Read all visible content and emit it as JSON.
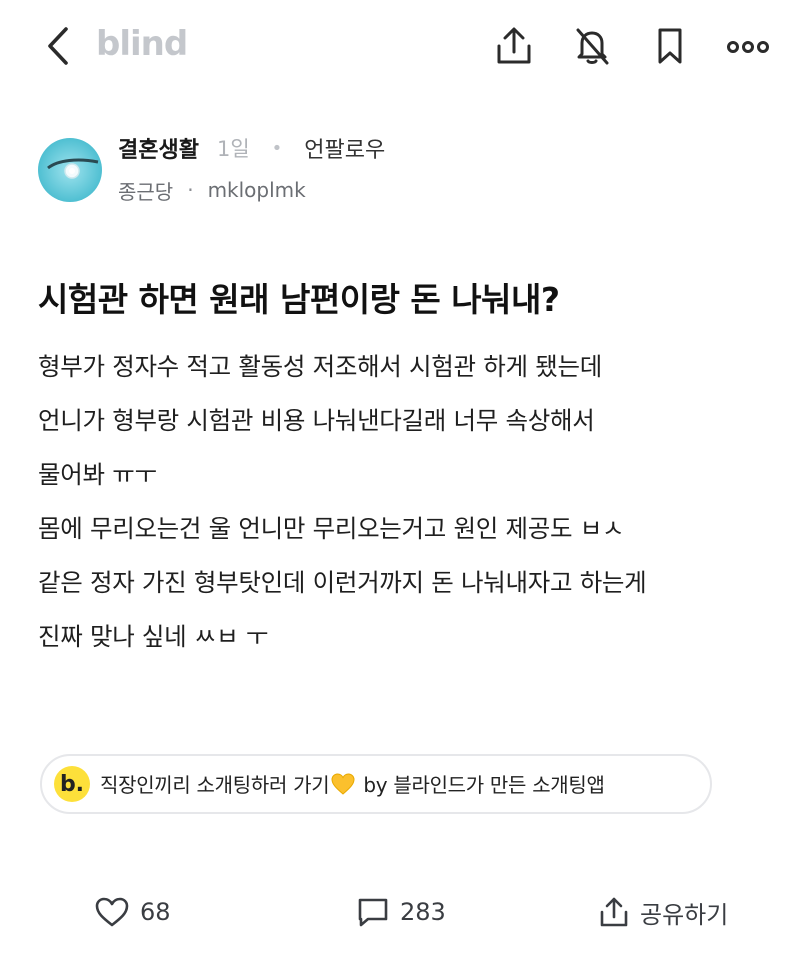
{
  "header": {
    "back_icon": "chevron-left-icon",
    "logo": "blind",
    "share_icon": "upload-icon",
    "mute_icon": "bell-off-icon",
    "bookmark_icon": "bookmark-icon",
    "more_icon": "more-horizontal-icon"
  },
  "author": {
    "channel": "결혼생활",
    "time": "1일",
    "separator": "•",
    "follow_label": "언팔로우",
    "company": "종근당",
    "mid_dot": "·",
    "nickname": "mkloplmk",
    "avatar_icon": "ring-photo-avatar"
  },
  "post": {
    "title": "시험관 하면 원래 남편이랑 돈 나눠내?",
    "lines": [
      "형부가 정자수 적고 활동성 저조해서 시험관 하게 됐는데",
      "언니가 형부랑 시험관 비용 나눠낸다길래 너무 속상해서",
      "물어봐 ㅠㅜ",
      "몸에 무리오는건 울 언니만 무리오는거고 원인 제공도 ㅂㅅ",
      "같은 정자 가진 형부탓인데 이런거까지 돈 나눠내자고 하는게",
      "진짜 맞나 싶네 ㅆㅂ ㅜ"
    ]
  },
  "promo": {
    "badge": "b.",
    "text_before": "직장인끼리 소개팅하러 가기",
    "heart_icon": "yellow-heart-icon",
    "text_after": " by 블라인드가 만든 소개팅앱",
    "badge_color": "#fde03a"
  },
  "actions": {
    "like_icon": "heart-outline-icon",
    "like_count": "68",
    "comment_icon": "comment-icon",
    "comment_count": "283",
    "share_icon": "share-icon",
    "share_label": "공유하기"
  }
}
